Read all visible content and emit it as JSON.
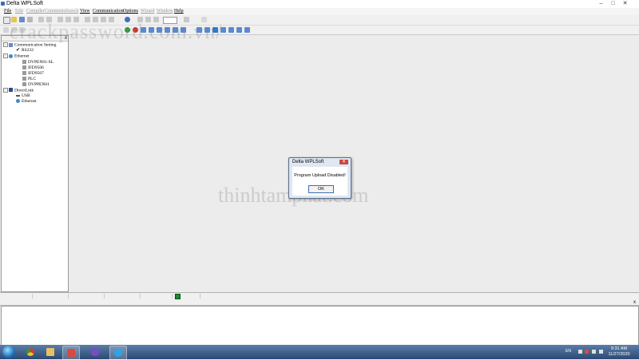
{
  "window": {
    "title": "Delta WPLSoft",
    "buttons": {
      "minimize": "–",
      "maximize": "□",
      "close": "✕"
    }
  },
  "menu": [
    {
      "label": "File",
      "enabled": true
    },
    {
      "label": "Edit",
      "enabled": false
    },
    {
      "label": "Compiler",
      "enabled": false
    },
    {
      "label": "Comments",
      "enabled": false
    },
    {
      "label": "Search",
      "enabled": false
    },
    {
      "label": "View",
      "enabled": true
    },
    {
      "label": "Communication",
      "enabled": true
    },
    {
      "label": "Options",
      "enabled": true
    },
    {
      "label": "Wizard",
      "enabled": false
    },
    {
      "label": "Window",
      "enabled": false
    },
    {
      "label": "Help",
      "enabled": true
    }
  ],
  "tree": {
    "close_label": "x",
    "nodes": [
      {
        "label": "Communication Setting",
        "level": 0,
        "expander": "−"
      },
      {
        "label": "RS232",
        "level": 1
      },
      {
        "label": "Ethernet",
        "level": 0,
        "expander": "−"
      },
      {
        "label": "DVPEN01-SL",
        "level": 2
      },
      {
        "label": "IFD9506",
        "level": 2
      },
      {
        "label": "IFD9507",
        "level": 2
      },
      {
        "label": "PLC",
        "level": 2
      },
      {
        "label": "DVPPEN01",
        "level": 2
      },
      {
        "label": "DirectLink",
        "level": 0,
        "expander": "−"
      },
      {
        "label": "USB",
        "level": 1
      },
      {
        "label": "Ethernet",
        "level": 1
      }
    ]
  },
  "output_panel": {
    "close_label": "x"
  },
  "watermarks": {
    "top": "crackpassword.com.vn/",
    "center": "thinhtamphat.com"
  },
  "dialog": {
    "title": "Delta WPLSoft",
    "close": "✕",
    "message": "Program Upload Disabled!",
    "ok_label": "OK"
  },
  "taskbar": {
    "language": "EN",
    "time": "9:31 AM",
    "date": "11/27/2020"
  },
  "colors": {
    "status_indicator": "#1d8a2e",
    "dialog_border": "#5a6e8a",
    "taskbar": "#2b4a73"
  }
}
